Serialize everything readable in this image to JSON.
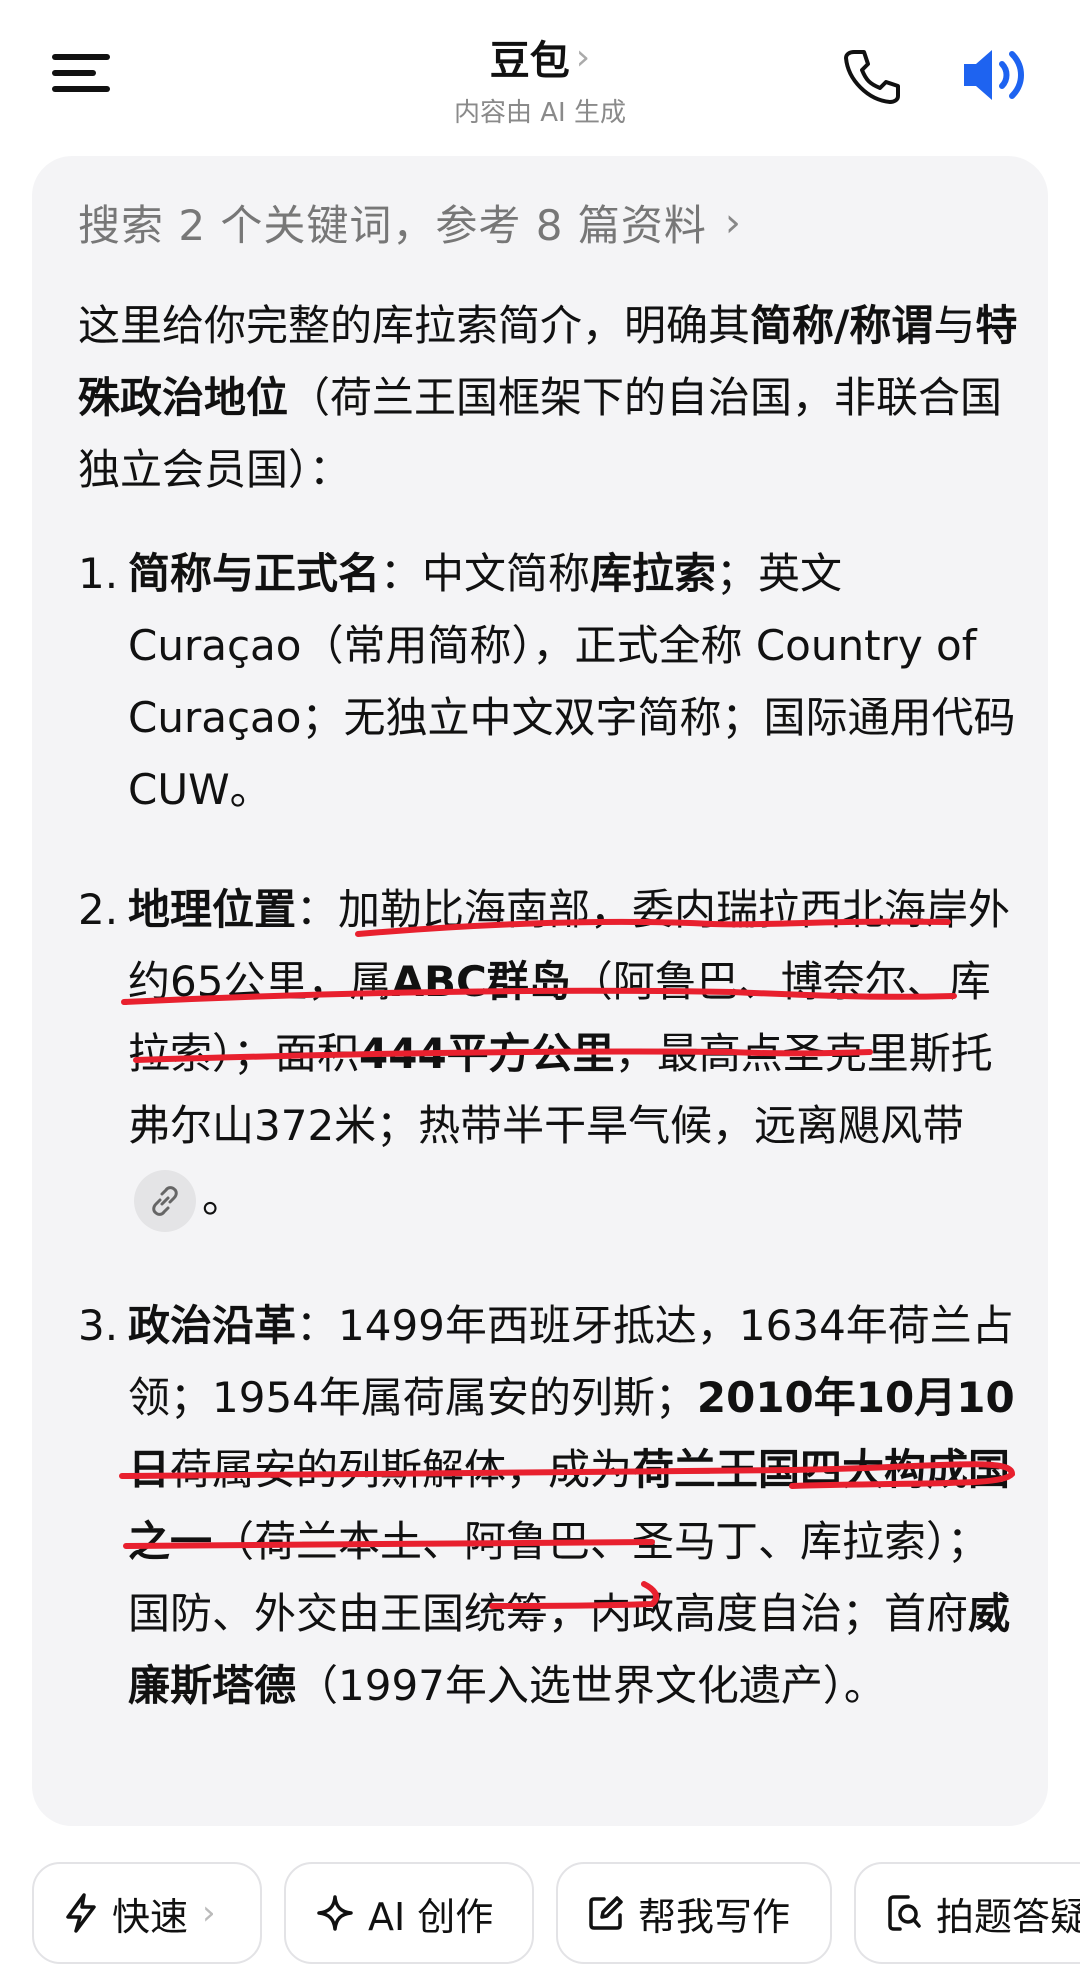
{
  "header": {
    "title": "豆包",
    "subtitle": "内容由 AI 生成"
  },
  "icons": {
    "menu": "menu-icon",
    "phone": "phone-icon",
    "speaker": "speaker-icon",
    "link": "link-icon",
    "arrow_down": "arrow-down-icon",
    "lightning": "lightning-icon",
    "sparkle": "sparkle-icon",
    "edit": "edit-icon",
    "photo_search": "photo-search-icon"
  },
  "colors": {
    "accent": "#1e63f0",
    "annotation": "#e8202e",
    "card_bg": "#f4f4f6"
  },
  "message": {
    "search_ref": "搜索 2 个关键词，参考 8 篇资料",
    "intro": {
      "t1": "这里给你完整的库拉索简介，明确其",
      "b1": "简称/称谓",
      "t2": "与",
      "b2": "特殊政治地位",
      "t3": "（荷兰王国框架下的自治国，非联合国独立会员国）："
    },
    "items": [
      {
        "num": "1.",
        "heading": "简称与正式名",
        "t1": "：中文简称",
        "b1": "库拉索",
        "t2": "；英文 Curaçao（常用简称），正式全称 Country of Curaçao；无独立中文双字简称；国际通用代码 CUW。"
      },
      {
        "num": "2.",
        "heading": "地理位置",
        "t1": "：加勒比海南部，委内瑞拉西北海岸外约65公里，属",
        "b1": "ABC群岛",
        "t2": "（阿鲁巴、博奈尔、库拉索）；面积",
        "b2": "444平方公里",
        "t3": "，最高点圣克里斯托弗尔山372米；热带半干旱气候，远离飓风带",
        "t4": "。"
      },
      {
        "num": "3.",
        "heading": "政治沿革",
        "t1": "：1499年西班牙抵达，1634年荷兰占领；1954年属荷属安的列斯；",
        "b1": "2010年10月10日",
        "t2": "荷属安的列斯解体，成为",
        "b2": "荷兰王国四大构成国之一",
        "t3": "（荷兰本土、阿鲁巴、圣马丁、库拉索）；国防、外交由王国统筹，内政高度自治；首府",
        "b3": "威廉斯塔德",
        "t4": "（1997年入选世界文化遗产）。"
      }
    ]
  },
  "actions": [
    {
      "label": "快速"
    },
    {
      "label": "AI 创作"
    },
    {
      "label": "帮我写作"
    },
    {
      "label": "拍题答疑"
    }
  ]
}
